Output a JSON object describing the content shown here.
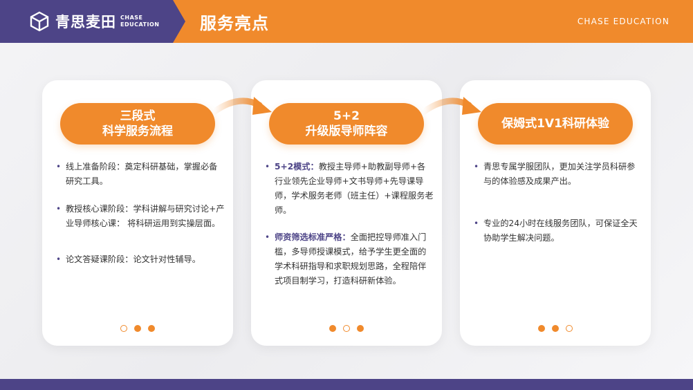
{
  "header": {
    "brand_cn": "青思麦田",
    "brand_en_1": "CHASE",
    "brand_en_2": "EDUCATION",
    "title": "服务亮点",
    "right_text": "CHASE EDUCATION"
  },
  "colors": {
    "orange": "#f08a2c",
    "purple": "#4d4487"
  },
  "cards": [
    {
      "title_1": "三段式",
      "title_2": "科学服务流程",
      "bullets": [
        {
          "text": "线上准备阶段：奠定科研基础，掌握必备研究工具。"
        },
        {
          "text": "教授核心课阶段：学科讲解与研究讨论+产业导师核心课： 将科研运用到实操层面。"
        },
        {
          "text": "论文答疑课阶段：论文针对性辅导。"
        }
      ]
    },
    {
      "title_1": "5+2",
      "title_2": "升级版导师阵容",
      "bullets": [
        {
          "bold": "5+2模式：",
          "text": "教授主导师+助教副导师+各行业领先企业导师+文书导师+先导课导师，学术服务老师（班主任）+课程服务老师。"
        },
        {
          "bold": "师资筛选标准严格：",
          "text": "全面把控导师准入门槛，多导师授课模式，给予学生更全面的学术科研指导和求职规划思路，全程陪伴式项目制学习，打造科研新体验。"
        }
      ]
    },
    {
      "title_1": "保姆式1V1科研体验",
      "bullets": [
        {
          "text": "青思专属学服团队，更加关注学员科研参与的体验感及成果产出。"
        },
        {
          "text": "专业的24小时在线服务团队，可保证全天协助学生解决问题。"
        }
      ]
    }
  ]
}
